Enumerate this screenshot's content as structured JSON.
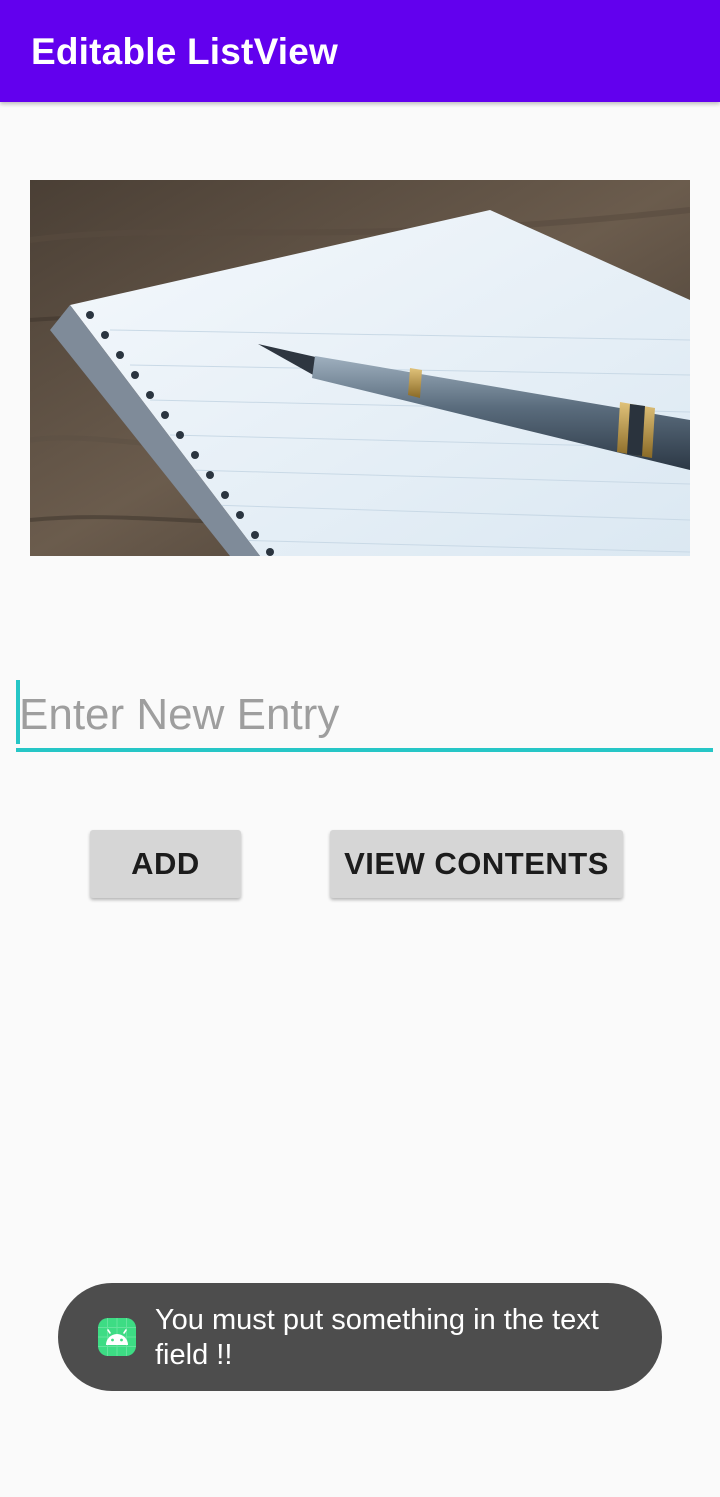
{
  "app_bar": {
    "title": "Editable ListView",
    "color": "#6200ee"
  },
  "hero_image": {
    "description": "notebook-with-fountain-pen"
  },
  "entry": {
    "value": "",
    "placeholder": "Enter New Entry",
    "accent_color": "#26c6c6"
  },
  "buttons": {
    "add_label": "ADD",
    "view_label": "VIEW CONTENTS"
  },
  "toast": {
    "icon": "android-app-icon",
    "message": "You must put something in the text field !!"
  }
}
